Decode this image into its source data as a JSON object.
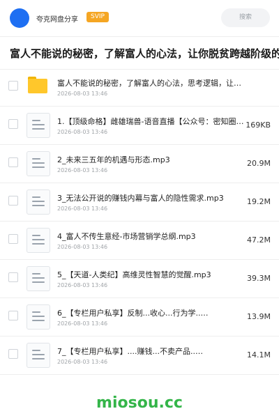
{
  "header": {
    "app_title": "夸克网盘分享",
    "badge": "SVIP",
    "search_placeholder": "搜索",
    "colors": {
      "avatar": "#1e6ff2",
      "badge": "#f5a623"
    }
  },
  "share": {
    "title": "富人不能说的秘密，了解富人的心法，让你脱贫跨越阶级的"
  },
  "files": [
    {
      "type": "folder",
      "name": "富人不能说的秘密，了解富人的心法，思考逻辑，让你脱…",
      "date": "2026-08-03 13:46",
      "size": ""
    },
    {
      "type": "file",
      "name": "1.【顶级命格】雌雄瑞兽-语音直播【公众号：密知圈…",
      "date": "2026-08-03 13:46",
      "size": "169KB"
    },
    {
      "type": "file",
      "name": "2_未来三五年的机遇与形态.mp3",
      "date": "2026-08-03 13:46",
      "size": "20.9M"
    },
    {
      "type": "file",
      "name": "3_无法公开说的赚钱内幕与富人的隐性需求.mp3",
      "date": "2026-08-03 13:46",
      "size": "19.2M"
    },
    {
      "type": "file",
      "name": "4_富人不传生意经-市场营销学总纲.mp3",
      "date": "2026-08-03 13:46",
      "size": "47.2M"
    },
    {
      "type": "file",
      "name": "5_【天道-人类纪】高维灵性智慧的觉醒.mp3",
      "date": "2026-08-03 13:46",
      "size": "39.3M"
    },
    {
      "type": "file",
      "name": "6_【专栏用户私享】反制...收心...行为学..…",
      "date": "2026-08-03 13:46",
      "size": "13.9M"
    },
    {
      "type": "file",
      "name": "7_【专栏用户私享】....赚钱...不卖产品..…",
      "date": "2026-08-03 13:46",
      "size": "14.1M"
    }
  ],
  "watermark": "miosou.cc"
}
